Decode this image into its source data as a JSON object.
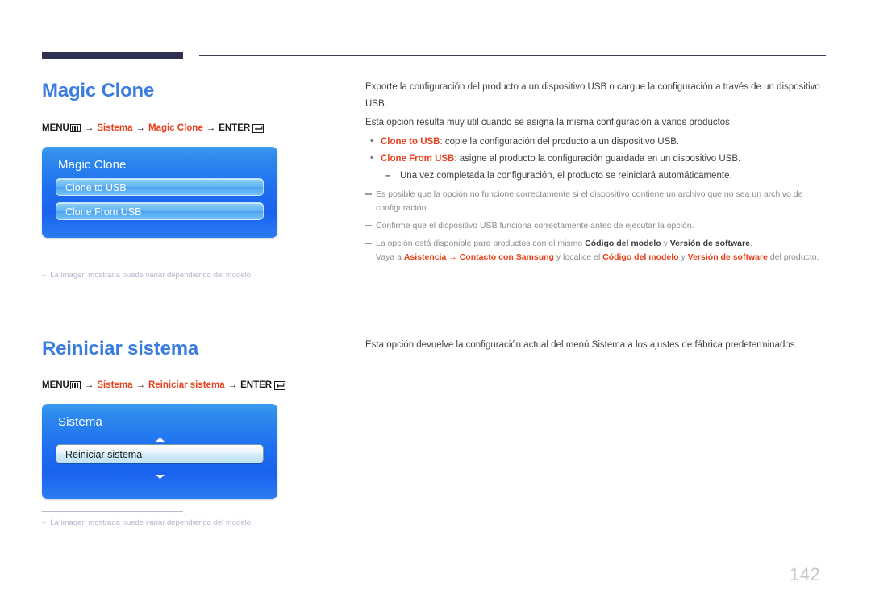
{
  "page": {
    "number": "142",
    "enter_icon": "enter-return-icon",
    "menu_icon": "menu-bars-icon"
  },
  "sections": [
    {
      "id": "magic-clone",
      "title": "Magic Clone",
      "menu_path": {
        "menu_label": "MENU",
        "arrow": "→",
        "step1": "Sistema",
        "step2": "Magic Clone",
        "enter_label": "ENTER"
      },
      "osd": {
        "title": "Magic Clone",
        "items": [
          {
            "label": "Clone to USB",
            "selected": false
          },
          {
            "label": "Clone From USB",
            "selected": false
          }
        ],
        "has_scroll_arrows": false
      },
      "footnote": {
        "dash": "–",
        "text": "La imagen mostrada puede variar dependiendo del modelo."
      },
      "body": {
        "paragraphs": [
          "Exporte la configuración del producto a un dispositivo USB o cargue la configuración a través de un dispositivo USB.",
          "Esta opción resulta muy útil cuando se asigna la misma configuración a varios productos."
        ],
        "bullets": [
          {
            "keyword": "Clone to USB",
            "text": ": copie la configuración del producto a un dispositivo USB."
          },
          {
            "keyword": "Clone From USB",
            "text": ": asigne al producto la configuración guardada en un dispositivo USB.",
            "subdash": "Una vez completada la configuración, el producto se reiniciará automáticamente."
          }
        ],
        "notes": [
          {
            "line1": "Es posible que la opción no funcione correctamente si el dispositivo contiene un archivo que no sea un archivo de",
            "line2": "configuración."
          },
          {
            "line1": "Confirme que el dispositivo USB funciona correctamente antes de ejecutar la opción."
          },
          {
            "prefix": "La opción está disponible para productos con el mismo ",
            "kw1": "Código del modelo",
            "mid1": " y ",
            "kw2": "Versión de software",
            "suffix": ".",
            "l2_prefix": "Vaya a ",
            "l2_kw1": "Asistencia",
            "l2_arrow": " → ",
            "l2_kw2": "Contacto con Samsung",
            "l2_mid": " y localice el ",
            "l2_kw3": "Código del modelo",
            "l2_mid2": " y ",
            "l2_kw4": "Versión de software",
            "l2_suffix": " del producto."
          }
        ]
      }
    },
    {
      "id": "reiniciar-sistema",
      "title": "Reiniciar sistema",
      "menu_path": {
        "menu_label": "MENU",
        "arrow": "→",
        "step1": "Sistema",
        "step2": "Reiniciar sistema",
        "enter_label": "ENTER"
      },
      "osd": {
        "title": "Sistema",
        "items": [
          {
            "label": "Reiniciar sistema",
            "selected": true
          }
        ],
        "has_scroll_arrows": true,
        "arrow_up": "scroll-up-arrow-icon",
        "arrow_down": "scroll-down-arrow-icon"
      },
      "footnote": {
        "dash": "–",
        "text": "La imagen mostrada puede variar dependiendo del modelo."
      },
      "body": {
        "paragraphs": [
          "Esta opción devuelve la configuración actual del menú Sistema a los ajustes de fábrica predeterminados."
        ]
      }
    }
  ],
  "colors": {
    "heading_blue": "#3b7ce0",
    "keyword_red": "#e8401c",
    "rule_navy": "#2e3154",
    "footnote_gray": "#b3b7cd",
    "page_number_gray": "#c8c8c8"
  }
}
